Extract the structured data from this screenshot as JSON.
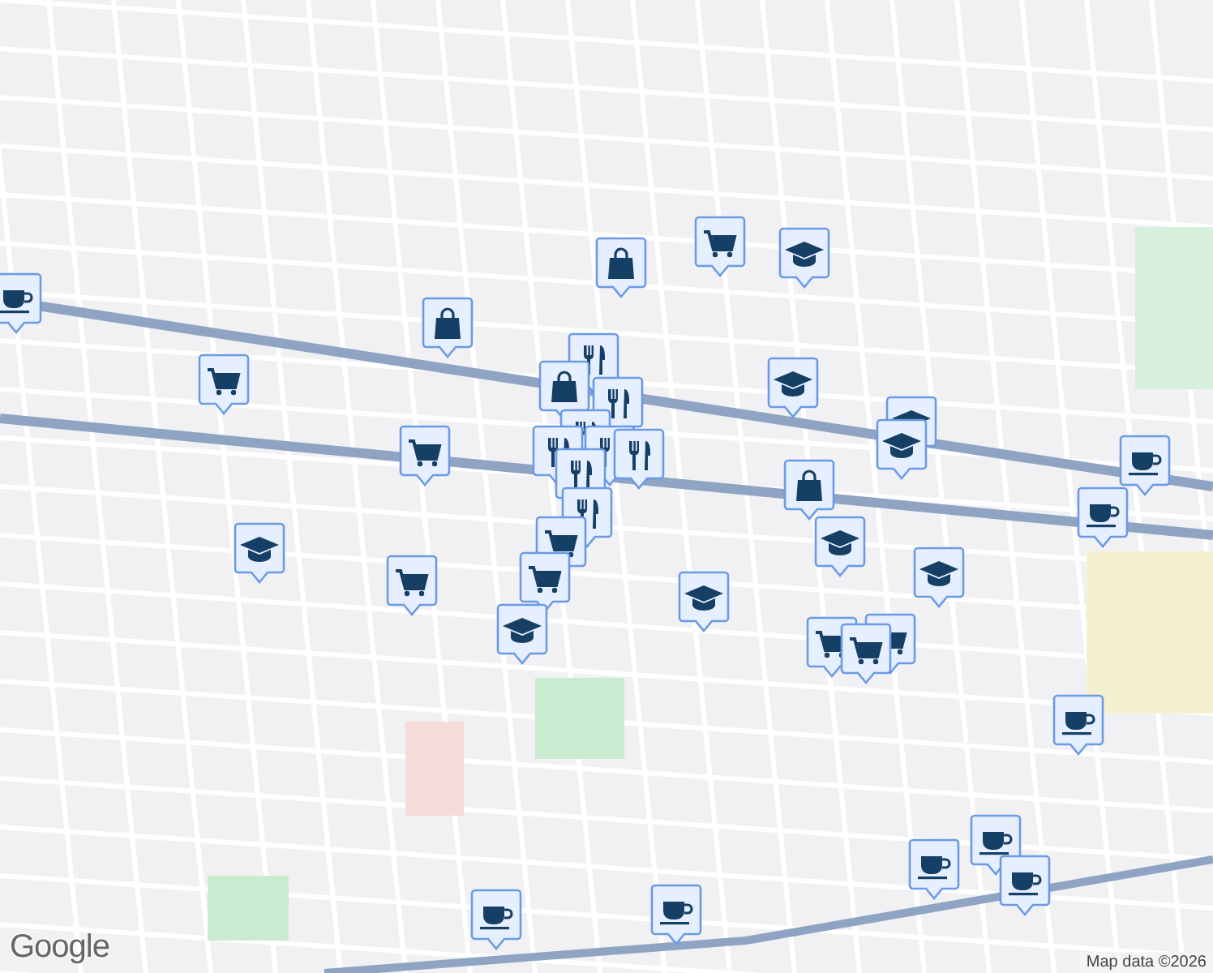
{
  "map": {
    "pins": [
      {
        "kind": "cafe"
      },
      {
        "kind": "shop"
      },
      {
        "kind": "shop"
      },
      {
        "kind": "grocery"
      },
      {
        "kind": "school"
      },
      {
        "kind": "grocery"
      },
      {
        "kind": "school"
      },
      {
        "kind": "school"
      },
      {
        "kind": "school"
      },
      {
        "kind": "grocery"
      },
      {
        "kind": "restaurant"
      },
      {
        "kind": "shop"
      },
      {
        "kind": "restaurant"
      },
      {
        "kind": "restaurant"
      },
      {
        "kind": "restaurant"
      },
      {
        "kind": "restaurant"
      },
      {
        "kind": "restaurant"
      },
      {
        "kind": "restaurant"
      },
      {
        "kind": "restaurant"
      },
      {
        "kind": "grocery"
      },
      {
        "kind": "shop"
      },
      {
        "kind": "cafe"
      },
      {
        "kind": "cafe"
      },
      {
        "kind": "school"
      },
      {
        "kind": "school"
      },
      {
        "kind": "school"
      },
      {
        "kind": "grocery"
      },
      {
        "kind": "grocery"
      },
      {
        "kind": "school"
      },
      {
        "kind": "school"
      },
      {
        "kind": "grocery"
      },
      {
        "kind": "grocery"
      },
      {
        "kind": "grocery"
      },
      {
        "kind": "cafe"
      },
      {
        "kind": "cafe"
      },
      {
        "kind": "cafe"
      },
      {
        "kind": "cafe"
      },
      {
        "kind": "cafe"
      },
      {
        "kind": "cafe"
      }
    ]
  },
  "attribution": {
    "logo": "Google",
    "text": "Map data ©2026"
  }
}
